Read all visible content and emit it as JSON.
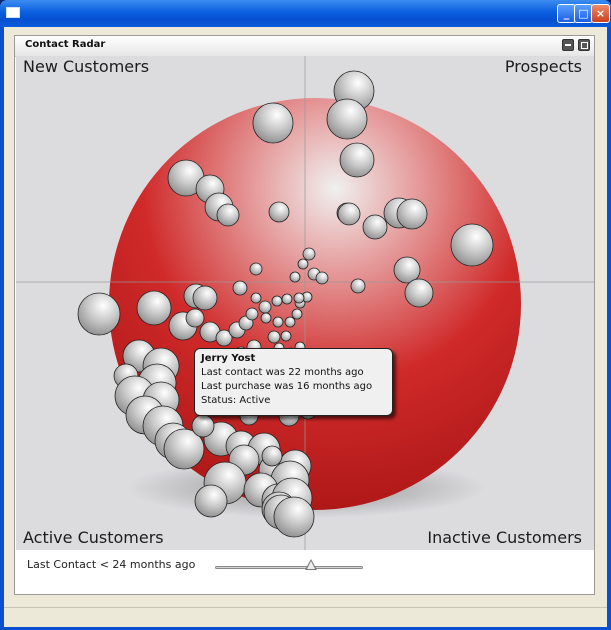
{
  "panel": {
    "title": "Contact Radar"
  },
  "quadrants": {
    "top_left": "New Customers",
    "top_right": "Prospects",
    "bottom_left": "Active Customers",
    "bottom_right": "Inactive Customers"
  },
  "slider": {
    "label": "Last Contact < 24 months ago",
    "value_months": 24,
    "position_fraction": 0.65
  },
  "tooltip": {
    "name": "Jerry Yost",
    "line1": "Last contact was 22 months ago",
    "line2": "Last purchase was 16 months ago",
    "line3": "Status: Active"
  },
  "colors": {
    "sphere": "#c81c1c",
    "contact_bubble": "#c8c8c8",
    "title_bar": "#0a5fe0"
  },
  "icons": {
    "minimize": "minimize-icon",
    "maximize": "maximize-icon",
    "close": "close-icon",
    "panel_minimize": "panel-minimize-icon",
    "panel_maximize": "panel-maximize-icon"
  }
}
